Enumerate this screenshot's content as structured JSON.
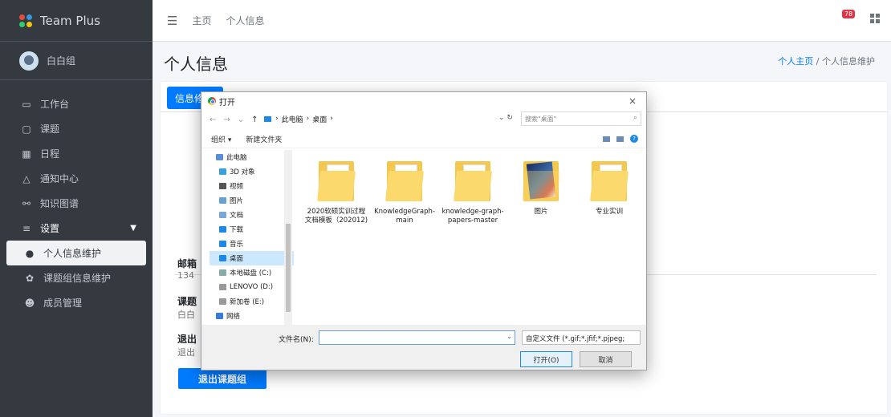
{
  "app": {
    "title": "Team Plus"
  },
  "user": {
    "name": "白白组"
  },
  "sidebar": {
    "items": [
      {
        "label": "工作台",
        "icon": "laptop-icon"
      },
      {
        "label": "课题",
        "icon": "monitor-icon"
      },
      {
        "label": "日程",
        "icon": "calendar-icon"
      },
      {
        "label": "通知中心",
        "icon": "bell-icon"
      },
      {
        "label": "知识图谱",
        "icon": "graph-icon"
      },
      {
        "label": "设置",
        "icon": "bars-icon"
      },
      {
        "label": "个人信息维护",
        "icon": "user-icon"
      },
      {
        "label": "课题组信息维护",
        "icon": "cogs-icon"
      },
      {
        "label": "成员管理",
        "icon": "users-icon"
      }
    ]
  },
  "topbar": {
    "home": "主页",
    "profile": "个人信息",
    "badge": "78"
  },
  "page": {
    "title": "个人信息",
    "breadcrumb_home": "个人主页",
    "breadcrumb_sep": "/",
    "breadcrumb_current": "个人信息维护"
  },
  "card": {
    "tab": "信息修",
    "email_label": "邮箱",
    "email_value": "134",
    "group_label": "课题",
    "group_value": "白白",
    "exit_label": "退出",
    "exit_value": "退出",
    "exit_button": "退出课题组"
  },
  "dialog": {
    "title": "打开",
    "close": "×",
    "path": [
      "此电脑",
      "桌面"
    ],
    "search_placeholder": "搜索\"桌面\"",
    "organize": "组织 ▾",
    "new_folder": "新建文件夹",
    "tree": [
      {
        "label": "此电脑",
        "color": "#5a8fd8"
      },
      {
        "label": "3D 对象",
        "color": "#3aa0d8"
      },
      {
        "label": "视频",
        "color": "#555"
      },
      {
        "label": "图片",
        "color": "#6aa0d0"
      },
      {
        "label": "文档",
        "color": "#7aa7d8"
      },
      {
        "label": "下载",
        "color": "#1e88e5"
      },
      {
        "label": "音乐",
        "color": "#1e88e5"
      },
      {
        "label": "桌面",
        "color": "#1e88e5"
      },
      {
        "label": "本地磁盘 (C:)",
        "color": "#8aa"
      },
      {
        "label": "LENOVO (D:)",
        "color": "#999"
      },
      {
        "label": "新加卷 (E:)",
        "color": "#999"
      },
      {
        "label": "网络",
        "color": "#3a7bd5"
      }
    ],
    "files": [
      {
        "name": "2020软硕实训过程文档模板（202012)",
        "kind": "docfolder"
      },
      {
        "name": "KnowledgeGraph-main",
        "kind": "folder"
      },
      {
        "name": "knowledge-graph-papers-master",
        "kind": "folder"
      },
      {
        "name": "图片",
        "kind": "imgfolder"
      },
      {
        "name": "专业实训",
        "kind": "docfolder"
      }
    ],
    "filename_label": "文件名(N):",
    "filename_value": "",
    "filter": "自定义文件 (*.gif;*.jfif;*.pjpeg;",
    "open": "打开(O)",
    "cancel": "取消"
  }
}
